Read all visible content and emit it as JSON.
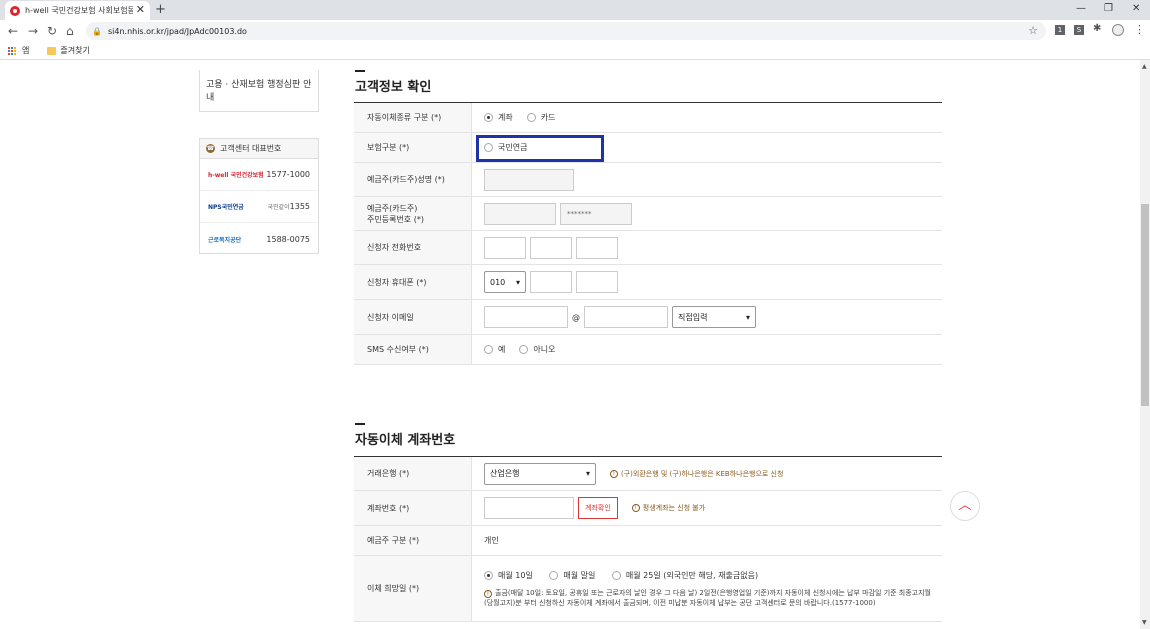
{
  "browser": {
    "tab_title": "h-well 국민건강보험 사회보험동",
    "tab_close": "✕",
    "new_tab": "+",
    "win_minimize": "—",
    "win_restore": "❐",
    "win_close": "✕",
    "url": "si4n.nhis.or.kr/jpad/JpAdc00103.do",
    "bookmarks": {
      "apps_label": "앱",
      "folder_label": "즐겨찾기"
    },
    "extensions": [
      "1",
      "S"
    ]
  },
  "sidebar": {
    "admin_appeal": "고용 · 산재보험 행정심판 안내",
    "contact_title": "고객센터 대표번호",
    "contacts": [
      {
        "logo": "h-well 국민건강보험",
        "number": "1577-1000",
        "logo_color": "#d9232e"
      },
      {
        "logo": "NPS국민연금",
        "prefix": "국민같이",
        "number": "1355",
        "logo_color": "#0a3c8c"
      },
      {
        "logo": "근로복지공단",
        "number": "1588-0075",
        "logo_color": "#1b6fb5"
      }
    ]
  },
  "customer_section": {
    "title": "고객정보 확인",
    "rows": {
      "auto_type": {
        "label": "자동이체종류 구분 (*)",
        "options": [
          "계좌",
          "카드"
        ],
        "selected": "계좌"
      },
      "insurance_type": {
        "label": "보험구분 (*)",
        "option": "국민연금"
      },
      "holder_name": {
        "label": "예금주(카드주)성명 (*)"
      },
      "holder_rrn": {
        "label_line1": "예금주(카드주)",
        "label_line2": "주민등록번호 (*)",
        "masked": "*******"
      },
      "phone": {
        "label": "신청자 전화번호"
      },
      "mobile": {
        "label": "신청자 휴대폰 (*)",
        "prefix": "010"
      },
      "email": {
        "label": "신청자 이메일",
        "at": "@",
        "domain_select": "직접입력"
      },
      "sms": {
        "label": "SMS 수신여부 (*)",
        "options": [
          "예",
          "아니오"
        ]
      }
    }
  },
  "account_section": {
    "title": "자동이체 계좌번호",
    "rows": {
      "bank": {
        "label": "거래은행 (*)",
        "selected": "산업은행",
        "note": "(구)외환은행 및 (구)하나은행은 KEB하나은행으로 신청"
      },
      "account_no": {
        "label": "계좌번호 (*)",
        "button": "계좌확인",
        "note": "평생계좌는 신청 불가"
      },
      "holder_type": {
        "label": "예금주 구분 (*)",
        "value": "개인"
      },
      "transfer_day": {
        "label": "이체 희망일 (*)",
        "options": [
          "매월 10일",
          "매월 말일",
          "매월 25일 (외국인만 해당, 재출금없음)"
        ],
        "selected": "매월 10일",
        "note": "출금(매달 10일: 토요일, 공휴일 또는 근로자의 날인 경우 그 다음 날) 2일전(은행영업일 기준)까지 자동이체 신청시에는 납부 마감일 기준 최종고지월(당월고지)분 부터 신청하신 자동이체 계좌에서 출금되며, 이전 미납분 자동이체 납부는 공단 고객센터로 문의 바랍니다.(1577-1000)"
      }
    }
  },
  "colors": {
    "highlight_border": "#1f33a8",
    "accent_red": "#dd3333",
    "note_brown": "#8a5a1e"
  },
  "icons": [
    "apps-icon",
    "folder-icon",
    "phone-icon",
    "lock-icon",
    "star-icon",
    "info-icon",
    "chevron-up-icon"
  ]
}
